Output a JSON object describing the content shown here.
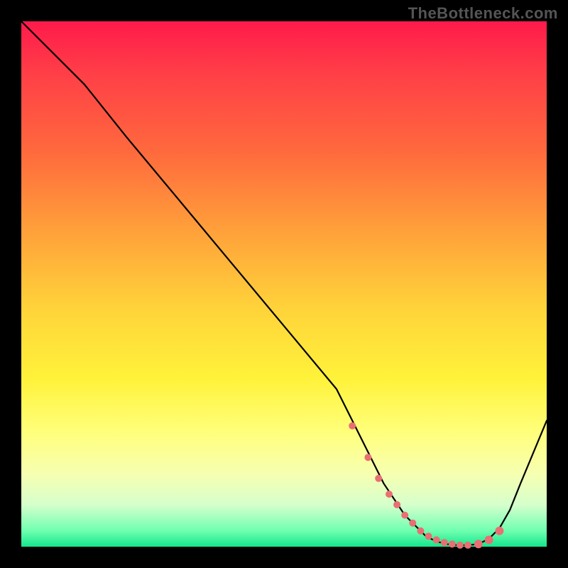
{
  "watermark": "TheBottleneck.com",
  "colors": {
    "page_bg": "#000000",
    "gradient_top": "#ff1a4b",
    "gradient_bottom": "#14e68c",
    "curve": "#000000",
    "markers": "#e86f72"
  },
  "chart_data": {
    "type": "line",
    "title": "",
    "xlabel": "",
    "ylabel": "",
    "xlim": [
      0,
      100
    ],
    "ylim": [
      0,
      100
    ],
    "series": [
      {
        "name": "bottleneck-curve",
        "x": [
          0,
          8,
          12,
          20,
          30,
          40,
          50,
          60,
          63,
          66,
          69,
          71,
          73,
          75,
          77,
          79,
          81,
          83,
          85,
          87,
          89,
          91,
          93,
          95,
          100
        ],
        "y": [
          100,
          92,
          88,
          78,
          66,
          54,
          42,
          30,
          24,
          18,
          12,
          9,
          6,
          4,
          2,
          1,
          0.5,
          0.3,
          0.3,
          0.5,
          1.5,
          3.5,
          7,
          12,
          24
        ]
      }
    ],
    "markers": {
      "name": "highlight-points",
      "x": [
        63,
        66,
        68,
        70,
        71.5,
        73,
        74.5,
        76,
        77.5,
        79,
        80.5,
        82,
        83.5,
        85,
        87,
        89,
        91
      ],
      "y": [
        23,
        17,
        13,
        10,
        8,
        6,
        4.5,
        3,
        2,
        1.3,
        0.8,
        0.5,
        0.3,
        0.3,
        0.5,
        1.3,
        3
      ],
      "r": [
        5,
        5,
        5,
        5,
        5,
        5,
        5,
        5,
        5,
        5,
        5,
        5,
        5,
        5,
        6,
        6,
        6
      ]
    }
  }
}
